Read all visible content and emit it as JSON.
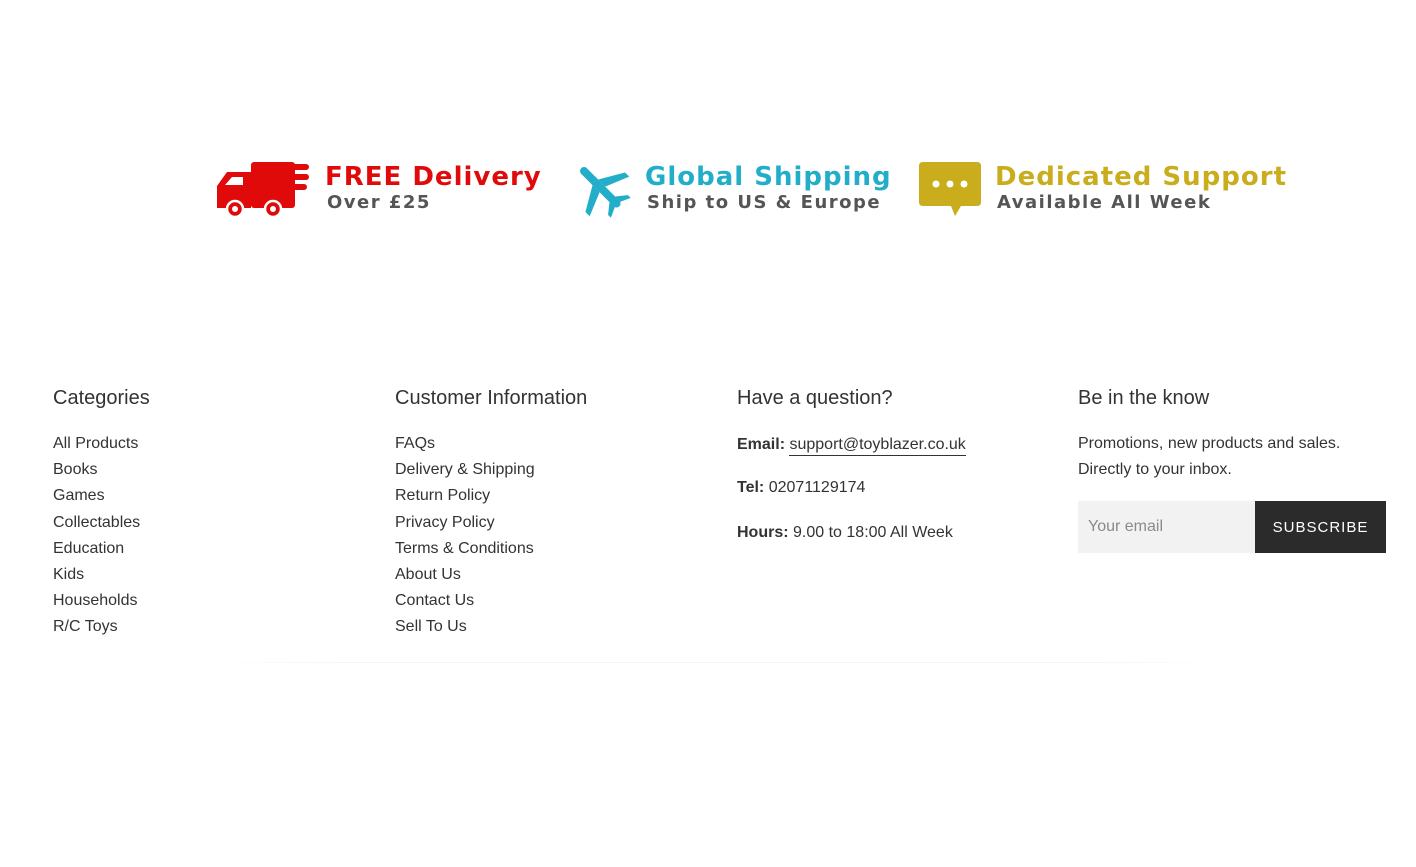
{
  "features": [
    {
      "icon": "delivery-truck-icon",
      "title": "FREE Delivery",
      "subtitle": "Over £25",
      "color": "#e00a0a"
    },
    {
      "icon": "airplane-icon",
      "title": "Global Shipping",
      "subtitle": "Ship to US & Europe",
      "color": "#22aec8"
    },
    {
      "icon": "chat-bubble-icon",
      "title": "Dedicated Support",
      "subtitle": "Available All Week",
      "color": "#c9ad1d"
    }
  ],
  "footer": {
    "categories": {
      "heading": "Categories",
      "links": [
        "All Products",
        "Books",
        "Games",
        "Collectables",
        "Education",
        "Kids",
        "Households",
        "R/C Toys"
      ]
    },
    "customer_info": {
      "heading": "Customer Information",
      "links": [
        "FAQs",
        "Delivery & Shipping",
        "Return Policy",
        "Privacy Policy",
        "Terms & Conditions",
        "About Us",
        "Contact Us",
        "Sell To Us"
      ]
    },
    "question": {
      "heading": "Have a question?",
      "email_label": "Email:",
      "email_value": "support@toyblazer.co.uk",
      "tel_label": "Tel:",
      "tel_value": "02071129174",
      "hours_label": "Hours:",
      "hours_value": "9.00 to 18:00 All Week"
    },
    "newsletter": {
      "heading": "Be in the know",
      "line1": "Promotions, new products and sales.",
      "line2": "Directly to your inbox.",
      "email_placeholder": "Your email",
      "email_value": "",
      "subscribe_label": "Subscribe"
    }
  },
  "colors": {
    "text": "#333333",
    "button_bg": "#2b2b2b",
    "input_bg": "#f2f2f2"
  }
}
